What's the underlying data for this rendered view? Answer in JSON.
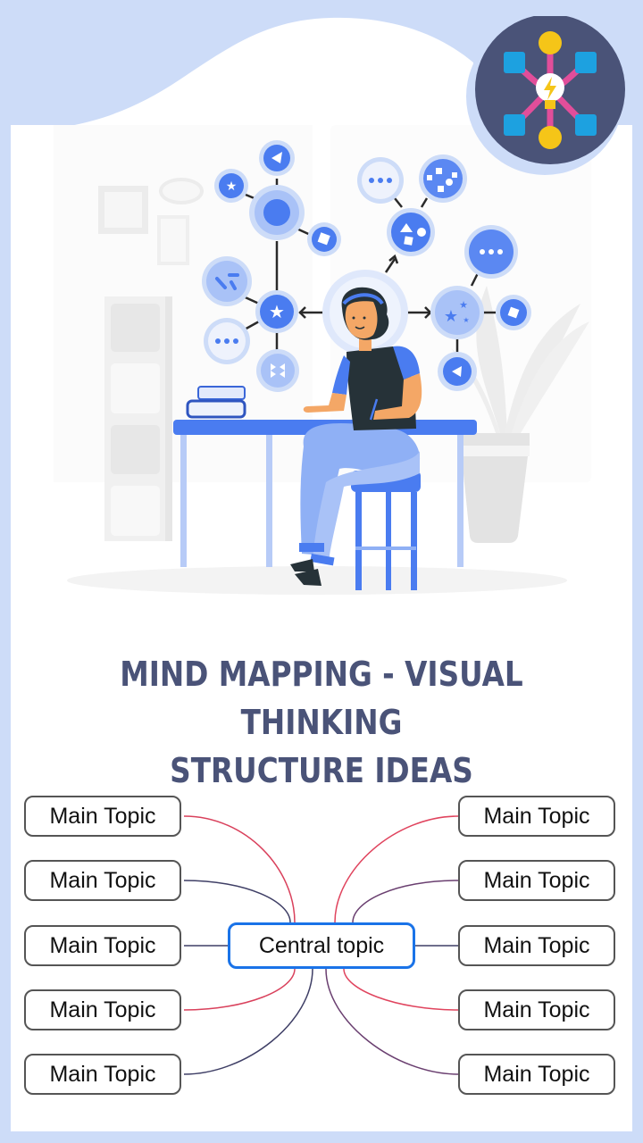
{
  "colors": {
    "background": "#cddcf8",
    "title": "#4a5378",
    "central_border": "#1a73e8",
    "topic_border": "#555555",
    "accent_blue": "#4a7cf0",
    "light_blue": "#a9c2f7",
    "app_icon_bg": "#4a5378"
  },
  "app_icon": {
    "name": "mind-map-lightbulb-icon"
  },
  "illustration": {
    "name": "woman-at-desk-mind-map-illustration"
  },
  "title": {
    "line1": "MIND MAPPING - VISUAL THINKING",
    "line2": "STRUCTURE IDEAS"
  },
  "mindmap": {
    "central": "Central topic",
    "left_topics": [
      "Main Topic",
      "Main Topic",
      "Main Topic",
      "Main Topic",
      "Main Topic"
    ],
    "right_topics": [
      "Main Topic",
      "Main Topic",
      "Main Topic",
      "Main Topic",
      "Main Topic"
    ],
    "connector_colors": [
      "#d9415c",
      "#3f3f66",
      "#3f3f66",
      "#d9415c",
      "#3f3f66"
    ],
    "right_connector_colors": [
      "#e0445e",
      "#6a3f70",
      "#3f3f66",
      "#e0445e",
      "#6a3f70"
    ]
  }
}
